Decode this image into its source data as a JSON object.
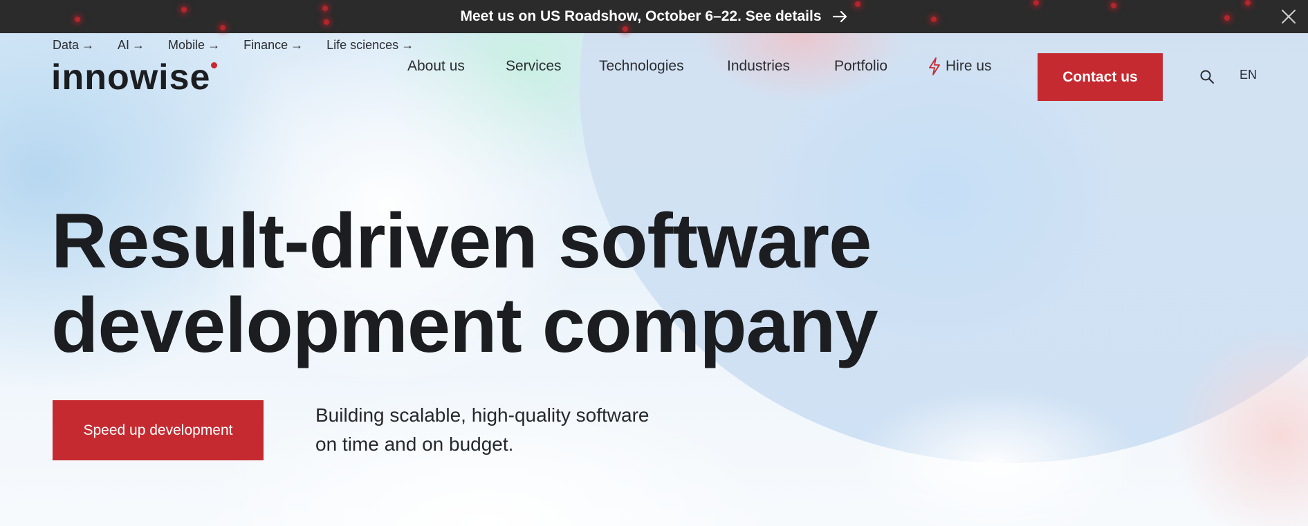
{
  "announcement": {
    "text": "Meet us on US Roadshow, October 6–22. See details",
    "arrow_icon": "arrow-right-icon",
    "close_icon": "close-icon"
  },
  "quick_links": [
    {
      "label": "Data"
    },
    {
      "label": "AI"
    },
    {
      "label": "Mobile"
    },
    {
      "label": "Finance"
    },
    {
      "label": "Life sciences"
    }
  ],
  "logo": {
    "text": "innowise"
  },
  "nav": {
    "items": [
      {
        "label": "About us"
      },
      {
        "label": "Services"
      },
      {
        "label": "Technologies"
      },
      {
        "label": "Industries"
      },
      {
        "label": "Portfolio"
      },
      {
        "label": "Hire us",
        "icon": "lightning-icon"
      }
    ],
    "contact_label": "Contact us",
    "search_icon": "search-icon",
    "language": "EN"
  },
  "hero": {
    "title_line1": "Result-driven software",
    "title_line2": "development company",
    "cta_label": "Speed up development",
    "subtitle_line1": "Building scalable, high-quality software",
    "subtitle_line2": "on time and on budget."
  },
  "colors": {
    "brand_red": "#c62a31",
    "announcement_bg": "#2b2b2b",
    "text_dark": "#1b1d20"
  }
}
